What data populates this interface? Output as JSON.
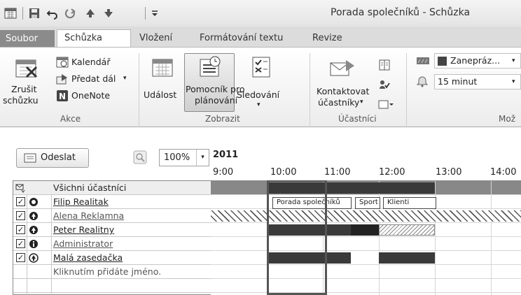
{
  "window": {
    "title": "Porada společníků - Schůzka"
  },
  "tabs": [
    {
      "label": "Soubor"
    },
    {
      "label": "Schůzka"
    },
    {
      "label": "Vložení"
    },
    {
      "label": "Formátování textu"
    },
    {
      "label": "Revize"
    }
  ],
  "ribbon": {
    "actions": {
      "cancel_line1": "Zrušit",
      "cancel_line2": "schůzku",
      "calendar": "Kalendář",
      "forward": "Předat dál",
      "onenote": "OneNote",
      "label": "Akce"
    },
    "show": {
      "appointment": "Událost",
      "scheduling_line1": "Pomocník pro",
      "scheduling_line2": "plánování",
      "tracking": "Sledování",
      "label": "Zobrazit"
    },
    "attendees": {
      "contact_line1": "Kontaktovat",
      "contact_line2": "účastníky",
      "label": "Účastníci"
    },
    "options": {
      "show_as": "Zanepráz...",
      "reminder": "15 minut",
      "label": "Mož"
    }
  },
  "toolbar": {
    "send": "Odeslat",
    "zoom": "100%"
  },
  "timeline": {
    "date": "2011",
    "times": [
      "9:00",
      "10:00",
      "11:00",
      "12:00",
      "13:00",
      "14:00"
    ]
  },
  "attendees": {
    "header": "Všichni účastníci",
    "list": [
      {
        "name": "Filip Realitak",
        "role": "organizer"
      },
      {
        "name": "Alena Reklamna",
        "role": "required"
      },
      {
        "name": "Peter Realitny",
        "role": "required"
      },
      {
        "name": "Administrator",
        "role": "optional"
      },
      {
        "name": "Malá zasedačka",
        "role": "resource"
      }
    ],
    "add_hint": "Kliknutím přidáte jméno."
  },
  "blocks": {
    "tag1": "Porada společníků",
    "tag2": "Sport",
    "tag3": "Klienti"
  },
  "colors": {
    "busy": "#3a3a3a",
    "ribbon_bg": "#ececec",
    "file_tab": "#8b8b8b"
  }
}
